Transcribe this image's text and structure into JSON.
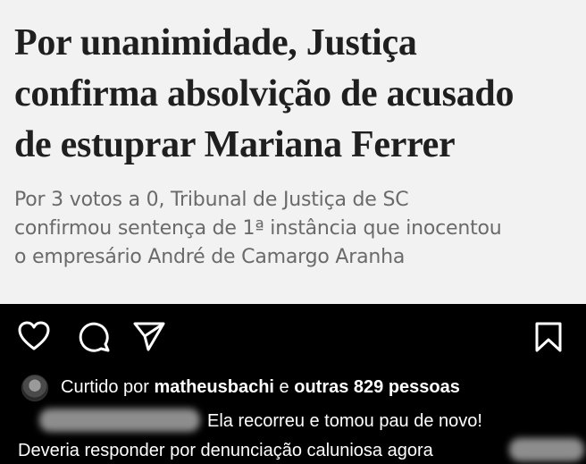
{
  "article": {
    "headline_lines": [
      "Por unanimidade, Justiça",
      "confirma absolvição de acusado",
      "de estuprar Mariana Ferrer"
    ],
    "subheadline_lines": [
      "Por 3 votos a 0, Tribunal de Justiça de SC",
      "confirmou sentença de 1ª instância que inocentou",
      "o empresário André de Camargo Aranha"
    ]
  },
  "instagram": {
    "actions": {
      "like_icon": "heart-icon",
      "comment_icon": "comment-icon",
      "share_icon": "send-icon",
      "save_icon": "bookmark-icon"
    },
    "liked_by": {
      "prefix": "Curtido por ",
      "username": "matheusbachi",
      "conjunction": " e ",
      "others": "outras 829 pessoas"
    },
    "comment": {
      "line1": "Ela recorreu e tomou pau de novo!",
      "line2": "Deveria responder por denunciação caluniosa agora"
    }
  },
  "colors": {
    "article_bg": "#f2f2f2",
    "headline": "#1f1f1f",
    "subheadline": "#6a6a6a",
    "ig_bg": "#000000",
    "ig_text": "#ffffff"
  }
}
